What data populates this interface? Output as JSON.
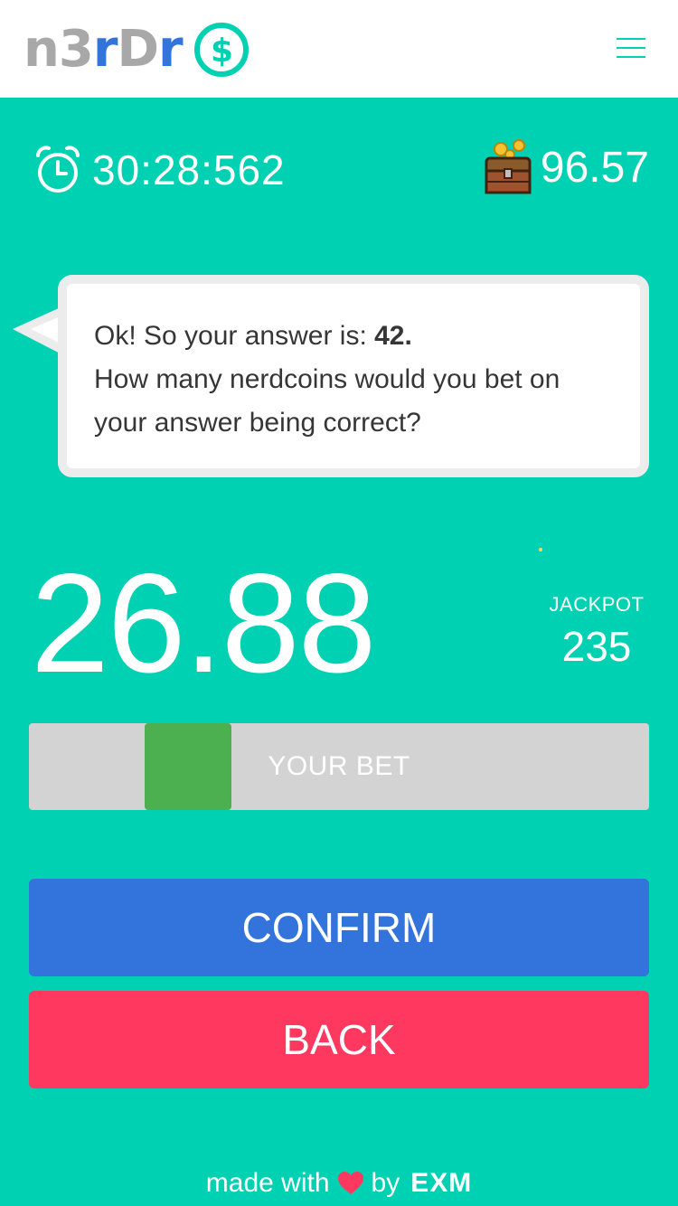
{
  "header": {
    "logo": {
      "part1": "n3",
      "part2": "r",
      "part3": "D",
      "part4": "r",
      "coin_icon": "dollar-coin-icon"
    },
    "menu_icon": "hamburger-menu-icon"
  },
  "status": {
    "timer": "30:28:562",
    "timer_icon": "alarm-clock-icon",
    "balance": "96.57",
    "balance_icon": "treasure-chest-icon"
  },
  "bubble": {
    "line1_prefix": "Ok! So your answer is: ",
    "answer": "42.",
    "line2": "How many nerdcoins would you bet on your answer being correct?"
  },
  "bet": {
    "amount": "26.88",
    "jackpot_label": "JACKPOT",
    "jackpot_value": "235",
    "slider_label": "YOUR BET"
  },
  "buttons": {
    "confirm": "CONFIRM",
    "back": "BACK"
  },
  "footer": {
    "made_with": "made with",
    "by": "by",
    "brand": "EXM"
  },
  "colors": {
    "background": "#00d1b2",
    "confirm": "#3273dc",
    "back": "#ff3860",
    "slider_thumb": "#4caf50",
    "slider_track": "#d3d3d3"
  }
}
